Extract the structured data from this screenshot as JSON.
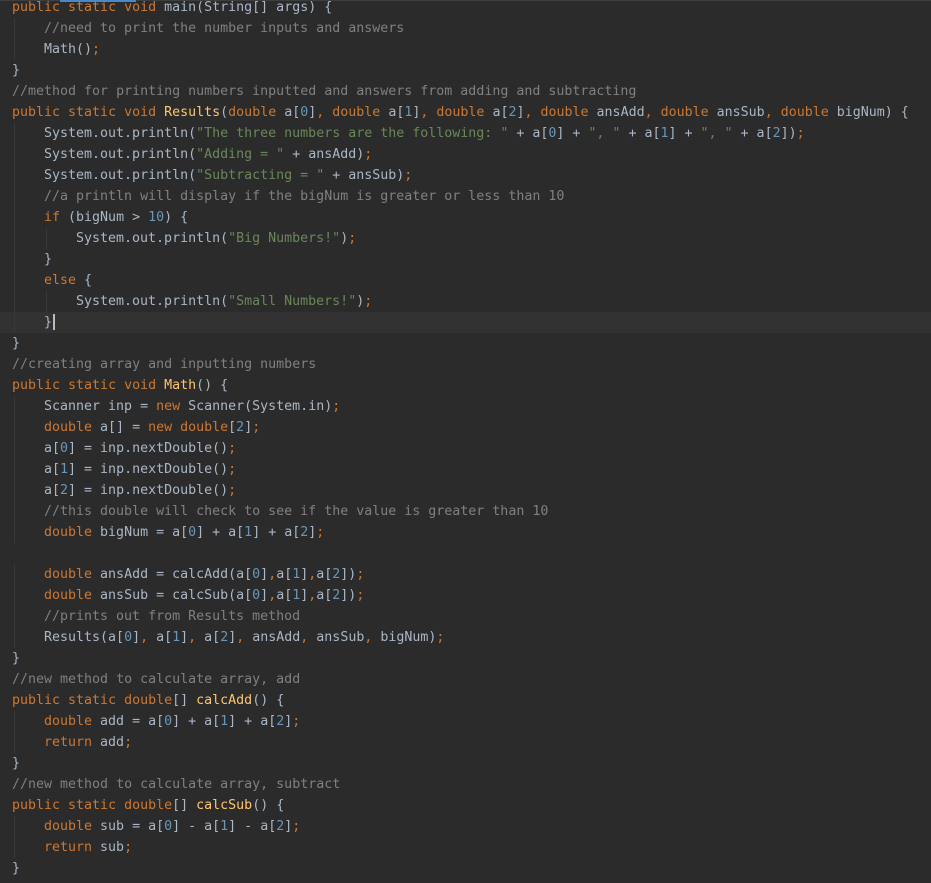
{
  "editor": {
    "language": "java",
    "colors": {
      "background": "#2b2b2b",
      "keyword": "#cc7832",
      "string": "#6a8759",
      "number": "#6897bb",
      "comment": "#808080",
      "method_declaration": "#ffc66d",
      "plain": "#a9b7c6",
      "current_line": "#323232"
    },
    "caret": {
      "line": 15
    },
    "lines": [
      {
        "indent": 0,
        "tokens": [
          [
            "kw",
            "public static void "
          ],
          [
            "pl",
            "main(String[] args) {"
          ]
        ]
      },
      {
        "indent": 1,
        "tokens": [
          [
            "cmt",
            "//need to print the number inputs and answers"
          ]
        ]
      },
      {
        "indent": 1,
        "tokens": [
          [
            "pl",
            "Math()"
          ],
          [
            "kw",
            ";"
          ]
        ]
      },
      {
        "indent": 0,
        "tokens": [
          [
            "pl",
            "}"
          ]
        ]
      },
      {
        "indent": 0,
        "tokens": [
          [
            "cmt",
            "//method for printing numbers inputted and answers from adding and subtracting"
          ]
        ]
      },
      {
        "indent": 0,
        "tokens": [
          [
            "kw",
            "public static void "
          ],
          [
            "fn",
            "Results"
          ],
          [
            "pl",
            "("
          ],
          [
            "kw",
            "double "
          ],
          [
            "pl",
            "a["
          ],
          [
            "num",
            "0"
          ],
          [
            "pl",
            "]"
          ],
          [
            "kw",
            ", double "
          ],
          [
            "pl",
            "a["
          ],
          [
            "num",
            "1"
          ],
          [
            "pl",
            "]"
          ],
          [
            "kw",
            ", double "
          ],
          [
            "pl",
            "a["
          ],
          [
            "num",
            "2"
          ],
          [
            "pl",
            "]"
          ],
          [
            "kw",
            ", double "
          ],
          [
            "pl",
            "ansAdd"
          ],
          [
            "kw",
            ", double "
          ],
          [
            "pl",
            "ansSub"
          ],
          [
            "kw",
            ", double "
          ],
          [
            "pl",
            "bigNum) {"
          ]
        ]
      },
      {
        "indent": 1,
        "tokens": [
          [
            "pl",
            "System.out.println("
          ],
          [
            "str",
            "\"The three numbers are the following: \" "
          ],
          [
            "pl",
            "+ a["
          ],
          [
            "num",
            "0"
          ],
          [
            "pl",
            "] + "
          ],
          [
            "str",
            "\", \" "
          ],
          [
            "pl",
            "+ a["
          ],
          [
            "num",
            "1"
          ],
          [
            "pl",
            "] + "
          ],
          [
            "str",
            "\", \" "
          ],
          [
            "pl",
            "+ a["
          ],
          [
            "num",
            "2"
          ],
          [
            "pl",
            "])"
          ],
          [
            "kw",
            ";"
          ]
        ]
      },
      {
        "indent": 1,
        "tokens": [
          [
            "pl",
            "System.out.println("
          ],
          [
            "str",
            "\"Adding = \" "
          ],
          [
            "pl",
            "+ ansAdd)"
          ],
          [
            "kw",
            ";"
          ]
        ]
      },
      {
        "indent": 1,
        "tokens": [
          [
            "pl",
            "System.out.println("
          ],
          [
            "str",
            "\"Subtracting = \" "
          ],
          [
            "pl",
            "+ ansSub)"
          ],
          [
            "kw",
            ";"
          ]
        ]
      },
      {
        "indent": 1,
        "tokens": [
          [
            "cmt",
            "//a println will display if the bigNum is greater or less than 10"
          ]
        ]
      },
      {
        "indent": 1,
        "tokens": [
          [
            "kw",
            "if "
          ],
          [
            "pl",
            "(bigNum > "
          ],
          [
            "num",
            "10"
          ],
          [
            "pl",
            ") {"
          ]
        ]
      },
      {
        "indent": 2,
        "tokens": [
          [
            "pl",
            "System.out.println("
          ],
          [
            "str",
            "\"Big Numbers!\""
          ],
          [
            "pl",
            ")"
          ],
          [
            "kw",
            ";"
          ]
        ]
      },
      {
        "indent": 1,
        "tokens": [
          [
            "pl",
            "}"
          ]
        ]
      },
      {
        "indent": 1,
        "tokens": [
          [
            "kw",
            "else "
          ],
          [
            "pl",
            "{"
          ]
        ]
      },
      {
        "indent": 2,
        "tokens": [
          [
            "pl",
            "System.out.println("
          ],
          [
            "str",
            "\"Small Numbers!\""
          ],
          [
            "pl",
            ")"
          ],
          [
            "kw",
            ";"
          ]
        ]
      },
      {
        "indent": 1,
        "tokens": [
          [
            "pl",
            "}"
          ]
        ]
      },
      {
        "indent": 0,
        "tokens": [
          [
            "pl",
            "}"
          ]
        ]
      },
      {
        "indent": 0,
        "tokens": [
          [
            "cmt",
            "//creating array and inputting numbers"
          ]
        ]
      },
      {
        "indent": 0,
        "tokens": [
          [
            "kw",
            "public static void "
          ],
          [
            "fn",
            "Math"
          ],
          [
            "pl",
            "() {"
          ]
        ]
      },
      {
        "indent": 1,
        "tokens": [
          [
            "pl",
            "Scanner inp = "
          ],
          [
            "kw",
            "new "
          ],
          [
            "pl",
            "Scanner(System.in)"
          ],
          [
            "kw",
            ";"
          ]
        ]
      },
      {
        "indent": 1,
        "tokens": [
          [
            "kw",
            "double "
          ],
          [
            "pl",
            "a[] = "
          ],
          [
            "kw",
            "new double"
          ],
          [
            "pl",
            "["
          ],
          [
            "num",
            "2"
          ],
          [
            "pl",
            "]"
          ],
          [
            "kw",
            ";"
          ]
        ]
      },
      {
        "indent": 1,
        "tokens": [
          [
            "pl",
            "a["
          ],
          [
            "num",
            "0"
          ],
          [
            "pl",
            "] = inp.nextDouble()"
          ],
          [
            "kw",
            ";"
          ]
        ]
      },
      {
        "indent": 1,
        "tokens": [
          [
            "pl",
            "a["
          ],
          [
            "num",
            "1"
          ],
          [
            "pl",
            "] = inp.nextDouble()"
          ],
          [
            "kw",
            ";"
          ]
        ]
      },
      {
        "indent": 1,
        "tokens": [
          [
            "pl",
            "a["
          ],
          [
            "num",
            "2"
          ],
          [
            "pl",
            "] = inp.nextDouble()"
          ],
          [
            "kw",
            ";"
          ]
        ]
      },
      {
        "indent": 1,
        "tokens": [
          [
            "cmt",
            "//this double will check to see if the value is greater than 10"
          ]
        ]
      },
      {
        "indent": 1,
        "tokens": [
          [
            "kw",
            "double "
          ],
          [
            "pl",
            "bigNum = a["
          ],
          [
            "num",
            "0"
          ],
          [
            "pl",
            "] + a["
          ],
          [
            "num",
            "1"
          ],
          [
            "pl",
            "] + a["
          ],
          [
            "num",
            "2"
          ],
          [
            "pl",
            "]"
          ],
          [
            "kw",
            ";"
          ]
        ]
      },
      {
        "indent": 0,
        "tokens": []
      },
      {
        "indent": 1,
        "tokens": [
          [
            "kw",
            "double "
          ],
          [
            "pl",
            "ansAdd = calcAdd(a["
          ],
          [
            "num",
            "0"
          ],
          [
            "pl",
            "]"
          ],
          [
            "kw",
            ","
          ],
          [
            "pl",
            "a["
          ],
          [
            "num",
            "1"
          ],
          [
            "pl",
            "]"
          ],
          [
            "kw",
            ","
          ],
          [
            "pl",
            "a["
          ],
          [
            "num",
            "2"
          ],
          [
            "pl",
            "])"
          ],
          [
            "kw",
            ";"
          ]
        ]
      },
      {
        "indent": 1,
        "tokens": [
          [
            "kw",
            "double "
          ],
          [
            "pl",
            "ansSub = calcSub(a["
          ],
          [
            "num",
            "0"
          ],
          [
            "pl",
            "]"
          ],
          [
            "kw",
            ","
          ],
          [
            "pl",
            "a["
          ],
          [
            "num",
            "1"
          ],
          [
            "pl",
            "]"
          ],
          [
            "kw",
            ","
          ],
          [
            "pl",
            "a["
          ],
          [
            "num",
            "2"
          ],
          [
            "pl",
            "])"
          ],
          [
            "kw",
            ";"
          ]
        ]
      },
      {
        "indent": 1,
        "tokens": [
          [
            "cmt",
            "//prints out from Results method"
          ]
        ]
      },
      {
        "indent": 1,
        "tokens": [
          [
            "pl",
            "Results(a["
          ],
          [
            "num",
            "0"
          ],
          [
            "pl",
            "]"
          ],
          [
            "kw",
            ", "
          ],
          [
            "pl",
            "a["
          ],
          [
            "num",
            "1"
          ],
          [
            "pl",
            "]"
          ],
          [
            "kw",
            ", "
          ],
          [
            "pl",
            "a["
          ],
          [
            "num",
            "2"
          ],
          [
            "pl",
            "]"
          ],
          [
            "kw",
            ", "
          ],
          [
            "pl",
            "ansAdd"
          ],
          [
            "kw",
            ", "
          ],
          [
            "pl",
            "ansSub"
          ],
          [
            "kw",
            ", "
          ],
          [
            "pl",
            "bigNum)"
          ],
          [
            "kw",
            ";"
          ]
        ]
      },
      {
        "indent": 0,
        "tokens": [
          [
            "pl",
            "}"
          ]
        ]
      },
      {
        "indent": 0,
        "tokens": [
          [
            "cmt",
            "//new method to calculate array, add"
          ]
        ]
      },
      {
        "indent": 0,
        "tokens": [
          [
            "kw",
            "public static double"
          ],
          [
            "pl",
            "[] "
          ],
          [
            "fn",
            "calcAdd"
          ],
          [
            "pl",
            "() {"
          ]
        ]
      },
      {
        "indent": 1,
        "tokens": [
          [
            "kw",
            "double "
          ],
          [
            "pl",
            "add = a["
          ],
          [
            "num",
            "0"
          ],
          [
            "pl",
            "] + a["
          ],
          [
            "num",
            "1"
          ],
          [
            "pl",
            "] + a["
          ],
          [
            "num",
            "2"
          ],
          [
            "pl",
            "]"
          ],
          [
            "kw",
            ";"
          ]
        ]
      },
      {
        "indent": 1,
        "tokens": [
          [
            "kw",
            "return "
          ],
          [
            "pl",
            "add"
          ],
          [
            "kw",
            ";"
          ]
        ]
      },
      {
        "indent": 0,
        "tokens": [
          [
            "pl",
            "}"
          ]
        ]
      },
      {
        "indent": 0,
        "tokens": [
          [
            "cmt",
            "//new method to calculate array, subtract"
          ]
        ]
      },
      {
        "indent": 0,
        "tokens": [
          [
            "kw",
            "public static double"
          ],
          [
            "pl",
            "[] "
          ],
          [
            "fn",
            "calcSub"
          ],
          [
            "pl",
            "() {"
          ]
        ]
      },
      {
        "indent": 1,
        "tokens": [
          [
            "kw",
            "double "
          ],
          [
            "pl",
            "sub = a["
          ],
          [
            "num",
            "0"
          ],
          [
            "pl",
            "] - a["
          ],
          [
            "num",
            "1"
          ],
          [
            "pl",
            "] - a["
          ],
          [
            "num",
            "2"
          ],
          [
            "pl",
            "]"
          ],
          [
            "kw",
            ";"
          ]
        ]
      },
      {
        "indent": 1,
        "tokens": [
          [
            "kw",
            "return "
          ],
          [
            "pl",
            "sub"
          ],
          [
            "kw",
            ";"
          ]
        ]
      },
      {
        "indent": 0,
        "tokens": [
          [
            "pl",
            "}"
          ]
        ]
      }
    ]
  }
}
